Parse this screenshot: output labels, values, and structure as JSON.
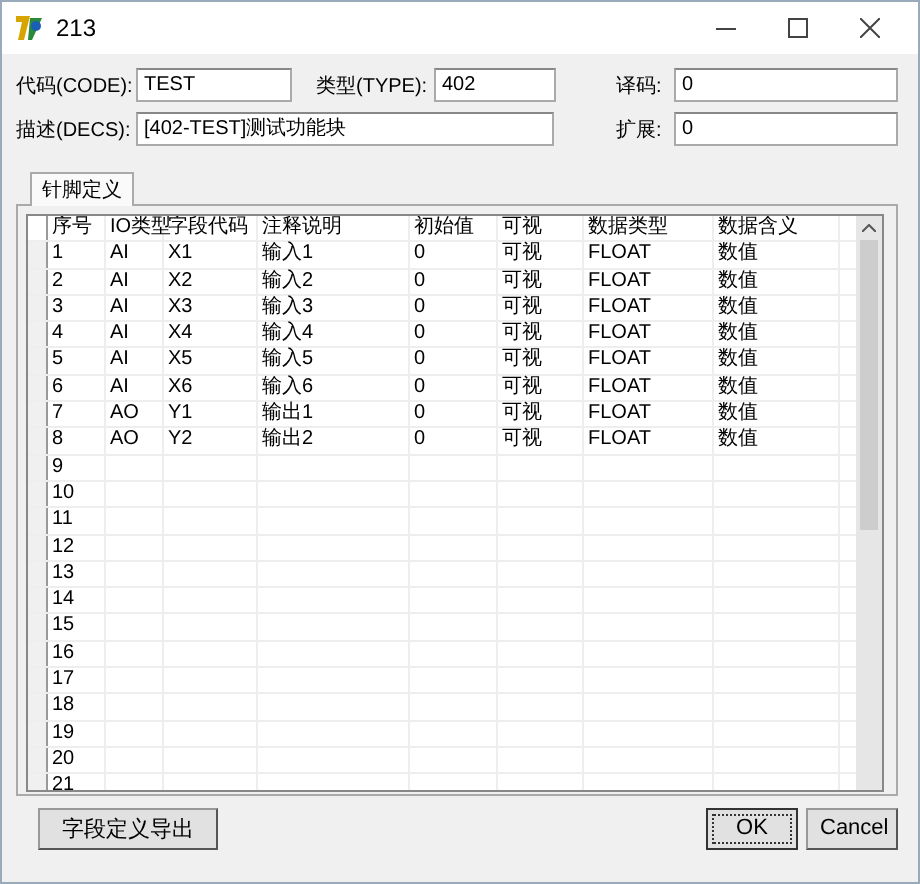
{
  "window": {
    "title": "213"
  },
  "form": {
    "code": {
      "label": "代码(CODE):",
      "value": "TEST"
    },
    "type": {
      "label": "类型(TYPE):",
      "value": "402"
    },
    "decode": {
      "label": "译码:",
      "value": "0"
    },
    "desc": {
      "label": "描述(DECS):",
      "value": "[402-TEST]测试功能块"
    },
    "ext": {
      "label": "扩展:",
      "value": "0"
    }
  },
  "tabs": [
    {
      "label": "针脚定义",
      "selected": true
    }
  ],
  "table": {
    "columns": [
      "序号",
      "IO类型",
      "字段代码",
      "注释说明",
      "初始值",
      "可视",
      "数据类型",
      "数据含义"
    ],
    "rows": [
      {
        "cells": [
          "1",
          "AI",
          "X1",
          "输入1",
          "0",
          "可视",
          "FLOAT",
          "数值"
        ]
      },
      {
        "cells": [
          "2",
          "AI",
          "X2",
          "输入2",
          "0",
          "可视",
          "FLOAT",
          "数值"
        ]
      },
      {
        "cells": [
          "3",
          "AI",
          "X3",
          "输入3",
          "0",
          "可视",
          "FLOAT",
          "数值"
        ]
      },
      {
        "cells": [
          "4",
          "AI",
          "X4",
          "输入4",
          "0",
          "可视",
          "FLOAT",
          "数值"
        ]
      },
      {
        "cells": [
          "5",
          "AI",
          "X5",
          "输入5",
          "0",
          "可视",
          "FLOAT",
          "数值"
        ]
      },
      {
        "cells": [
          "6",
          "AI",
          "X6",
          "输入6",
          "0",
          "可视",
          "FLOAT",
          "数值"
        ]
      },
      {
        "cells": [
          "7",
          "AO",
          "Y1",
          "输出1",
          "0",
          "可视",
          "FLOAT",
          "数值"
        ]
      },
      {
        "cells": [
          "8",
          "AO",
          "Y2",
          "输出2",
          "0",
          "可视",
          "FLOAT",
          "数值"
        ]
      },
      {
        "cells": [
          "9"
        ]
      },
      {
        "cells": [
          "10"
        ]
      },
      {
        "cells": [
          "11"
        ]
      },
      {
        "cells": [
          "12"
        ]
      },
      {
        "cells": [
          "13"
        ]
      },
      {
        "cells": [
          "14"
        ]
      },
      {
        "cells": [
          "15"
        ]
      },
      {
        "cells": [
          "16"
        ]
      },
      {
        "cells": [
          "17"
        ]
      },
      {
        "cells": [
          "18"
        ]
      },
      {
        "cells": [
          "19"
        ]
      },
      {
        "cells": [
          "20"
        ]
      },
      {
        "cells": [
          "21"
        ]
      }
    ]
  },
  "export_button": "字段定义导出",
  "buttons": [
    {
      "label": "OK",
      "default": true
    },
    {
      "label": "Cancel",
      "default": false
    }
  ]
}
